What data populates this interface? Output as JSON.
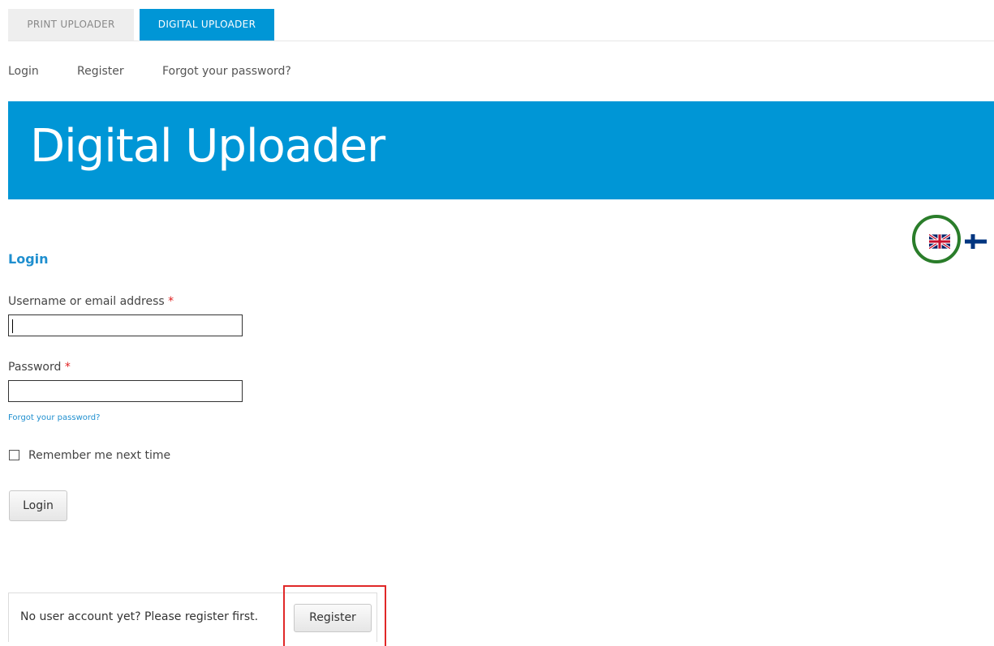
{
  "tabs": [
    {
      "label": "PRINT UPLOADER",
      "active": false
    },
    {
      "label": "DIGITAL UPLOADER",
      "active": true
    }
  ],
  "subnav": {
    "login": "Login",
    "register": "Register",
    "forgot": "Forgot your password?"
  },
  "banner": {
    "title": "Digital Uploader",
    "color": "#0096d6"
  },
  "languages": [
    {
      "icon": "uk-flag-icon",
      "selected": true
    },
    {
      "icon": "finland-flag-icon",
      "selected": false
    }
  ],
  "login_form": {
    "title": "Login",
    "username_label": "Username or email address",
    "username_value": "",
    "password_label": "Password",
    "password_value": "",
    "required_marker": "*",
    "forgot_link": "Forgot your password?",
    "remember_label": "Remember me next time",
    "remember_checked": false,
    "submit_label": "Login"
  },
  "register_prompt": {
    "text": "No user account yet? Please register first.",
    "button_label": "Register"
  },
  "colors": {
    "accent": "#0096d6",
    "link": "#1f8fcf",
    "required": "#e02020",
    "highlight_circle": "#2a7d2a",
    "highlight_box": "#e02828"
  }
}
